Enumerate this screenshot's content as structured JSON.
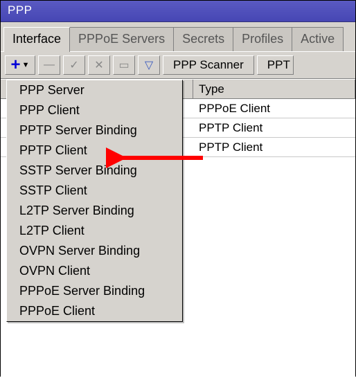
{
  "window": {
    "title": "PPP"
  },
  "tabs": [
    {
      "label": "Interface",
      "active": true
    },
    {
      "label": "PPPoE Servers",
      "active": false
    },
    {
      "label": "Secrets",
      "active": false
    },
    {
      "label": "Profiles",
      "active": false
    },
    {
      "label": "Active",
      "active": false
    }
  ],
  "toolbar": {
    "ppp_scanner": "PPP Scanner",
    "pptp_truncated": "PPT"
  },
  "table": {
    "headers": {
      "name": "",
      "type": "Type"
    },
    "rows": [
      {
        "name": "",
        "type": "PPPoE Client"
      },
      {
        "name": "",
        "type": "PPTP Client"
      },
      {
        "name": "",
        "type": "PPTP Client"
      }
    ]
  },
  "add_menu": {
    "items": [
      "PPP Server",
      "PPP Client",
      "PPTP Server Binding",
      "PPTP Client",
      "SSTP Server Binding",
      "SSTP Client",
      "L2TP Server Binding",
      "L2TP Client",
      "OVPN Server Binding",
      "OVPN Client",
      "PPPoE Server Binding",
      "PPPoE Client"
    ]
  },
  "annotation": {
    "arrow_target": "PPTP Client",
    "color": "#ff0000"
  }
}
